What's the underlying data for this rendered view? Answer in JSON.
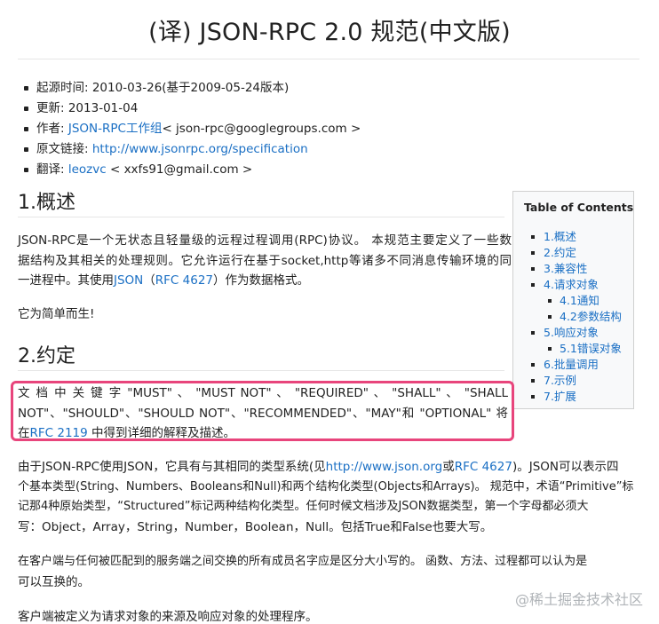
{
  "title": "(译) JSON-RPC 2.0 规范(中文版)",
  "meta": {
    "origin_time": "起源时间: 2010-03-26(基于2009-05-24版本)",
    "updated": "更新: 2013-01-04",
    "author_label": "作者: ",
    "author_link": "JSON-RPC工作组",
    "author_email": "< json-rpc@googlegroups.com >",
    "source_label": "原文链接: ",
    "source_link": "http://www.jsonrpc.org/specification",
    "translator_label": "翻译: ",
    "translator_link": "leozvc",
    "translator_email": " < xxfs91@gmail.com >"
  },
  "toc": {
    "title": "Table of Contents",
    "items": [
      {
        "label": "1.概述"
      },
      {
        "label": "2.约定"
      },
      {
        "label": "3.兼容性"
      },
      {
        "label": "4.请求对象"
      },
      {
        "label": "4.1通知"
      },
      {
        "label": "4.2参数结构"
      },
      {
        "label": "5.响应对象"
      },
      {
        "label": "5.1错误对象"
      },
      {
        "label": "6.批量调用"
      },
      {
        "label": "7.示例"
      },
      {
        "label": "7.扩展"
      }
    ]
  },
  "section1": {
    "heading": "1.概述",
    "p1_line1": "JSON-RPC是一个无状态且轻量级的远程过程调用(RPC)协议。 本规范主要定义了一些数",
    "p1_line2": "据结构及其相关的处理规则。它允许运行在基于socket,http等诸多不同消息传输环境的同",
    "p1_line3_pre": "一进程中。其使用",
    "p1_link_json": "JSON",
    "p1_mid": "（",
    "p1_link_rfc": "RFC 4627",
    "p1_post": "）作为数据格式。",
    "p2": "它为简单而生!"
  },
  "section2": {
    "heading": "2.约定",
    "hl_line1": "文 档 中 关 键 字 \"MUST\" 、 \"MUST NOT\" 、 \"REQUIRED\" 、 \"SHALL\" 、 \"SHALL",
    "hl_line2": "NOT\"、\"SHOULD\"、\"SHOULD NOT\"、\"RECOMMENDED\"、\"MAY\"和 \"OPTIONAL\" 将",
    "hl_line3_pre": "在",
    "hl_link": "RFC 2119",
    "hl_line3_post": " 中得到详细的解释及描述。",
    "p2_line1_pre": "由于JSON-RPC使用JSON，它具有与其相同的类型系统(见",
    "p2_link_json": "http://www.json.org",
    "p2_or": "或",
    "p2_link_rfc": "RFC 4627",
    "p2_line1_post": ")。JSON可以表示四",
    "p2_line2": "个基本类型(String、Numbers、Booleans和Null)和两个结构化类型(Objects和Arrays)。 规范中，术语“Primitive”标",
    "p2_line3": "记那4种原始类型，“Structured”标记两种结构化类型。任何时候文档涉及JSON数据类型，第一个字母都必须大",
    "p2_line4": "写：Object，Array，String，Number，Boolean，Null。包括True和False也要大写。",
    "p3_line1": "在客户端与任何被匹配到的服务端之间交换的所有成员名字应是区分大小写的。 函数、方法、过程都可以认为是",
    "p3_line2": "可以互换的。",
    "p4": "客户端被定义为请求对象的来源及响应对象的处理程序。"
  },
  "watermark": "@稀土掘金技术社区"
}
